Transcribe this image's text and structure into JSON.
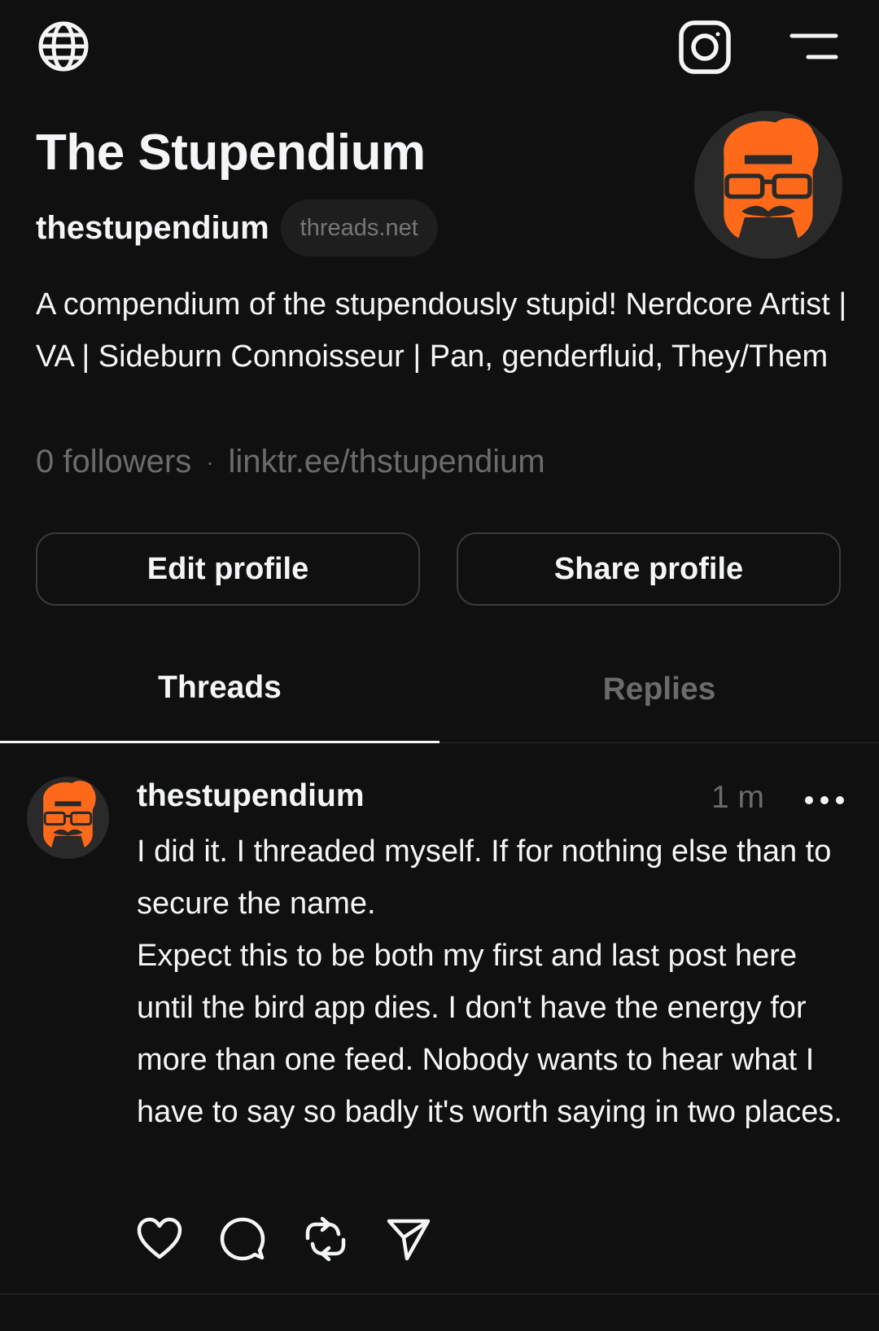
{
  "header": {
    "globe_icon": "globe-icon",
    "instagram_icon": "instagram-icon",
    "menu_icon": "menu-icon"
  },
  "profile": {
    "display_name": "The Stupendium",
    "handle": "thestupendium",
    "domain_badge": "threads.net",
    "bio": "A compendium of the stupendously stupid! Nerdcore Artist | VA | Sideburn Connoisseur | Pan, genderfluid, They/Them",
    "followers": "0 followers",
    "separator": "·",
    "link": "linktr.ee/thstupendium",
    "avatar_colors": {
      "accent": "#ff6a1a",
      "background": "#2a2a2a"
    }
  },
  "buttons": {
    "edit_label": "Edit profile",
    "share_label": "Share profile"
  },
  "tabs": [
    {
      "label": "Threads",
      "active": true
    },
    {
      "label": "Replies",
      "active": false
    }
  ],
  "post": {
    "username": "thestupendium",
    "time": "1 m",
    "paragraphs": [
      "I did it. I threaded myself. If for nothing else than to secure the name.",
      "Expect this to be both my first and last post here until the bird app dies. I don't have the energy for more than one feed. Nobody wants to hear what I have to say so badly it's worth saying in two places."
    ],
    "actions": [
      "heart-icon",
      "comment-icon",
      "repost-icon",
      "send-icon"
    ]
  },
  "colors": {
    "background": "#101010",
    "text": "#f3f5f7",
    "muted": "#6b6b6b",
    "border": "#3a3a3a",
    "brand_orange": "#ff6a1a"
  }
}
